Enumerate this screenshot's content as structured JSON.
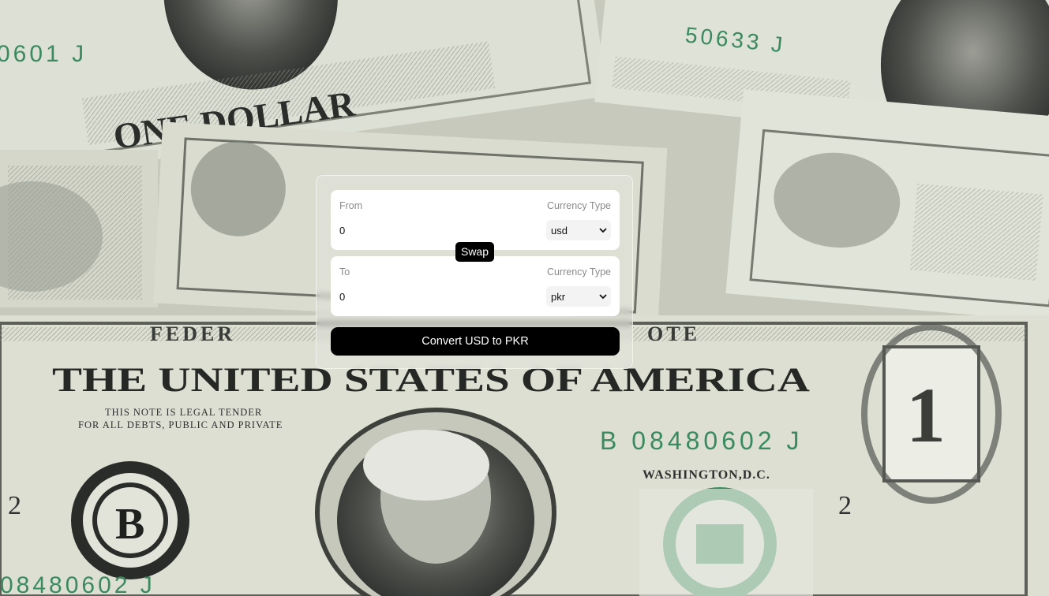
{
  "converter": {
    "from": {
      "label": "From",
      "currency_type_label": "Currency Type",
      "amount": "0",
      "currency": "usd"
    },
    "to": {
      "label": "To",
      "currency_type_label": "Currency Type",
      "amount": "0",
      "currency": "pkr"
    },
    "swap_label": "Swap",
    "convert_label": "Convert USD to PKR"
  },
  "background": {
    "motif": "dollar-bills-photo",
    "printed_text": {
      "serial_top_left": "0601 J",
      "serial_top_right": "50633 J",
      "one_dollar": "ONE DOLLAR",
      "federal": "FEDER",
      "note": "OTE",
      "usa": "THE UNITED STATES OF AMERICA",
      "legal_line1": "THIS NOTE IS LEGAL TENDER",
      "legal_line2": "FOR ALL DEBTS, PUBLIC AND PRIVATE",
      "serial_main": "B 08480602 J",
      "washington": "WASHINGTON,D.C.",
      "digit_two_left": "2",
      "digit_two_right": "2",
      "digit_one": "1",
      "seal_letter": "B",
      "serial_bottom": "08480602 J"
    }
  },
  "colors": {
    "accent": "#000000",
    "card_fill": "#ffffff",
    "label_gray": "#8a8a8a",
    "serial_green": "#3a8a5f",
    "bill_paper": "#dcdfd2"
  }
}
